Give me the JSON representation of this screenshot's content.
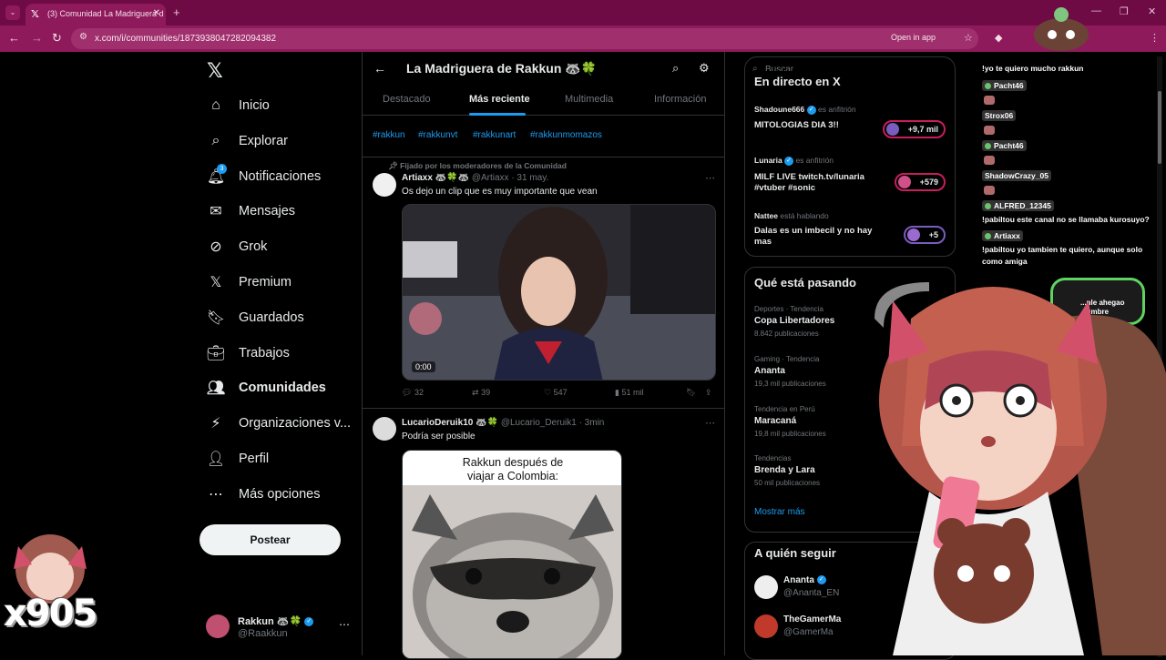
{
  "browser": {
    "tab_title": "(3) Comunidad La Madriguera d",
    "url": "x.com/i/communities/1873938047282094382",
    "open_in_app": "Open in app"
  },
  "nav": {
    "items": [
      {
        "label": "Inicio",
        "icon": "home-icon"
      },
      {
        "label": "Explorar",
        "icon": "search-icon"
      },
      {
        "label": "Notificaciones",
        "icon": "bell-icon",
        "badge": "3"
      },
      {
        "label": "Mensajes",
        "icon": "mail-icon"
      },
      {
        "label": "Grok",
        "icon": "grok-icon"
      },
      {
        "label": "Premium",
        "icon": "x-icon"
      },
      {
        "label": "Guardados",
        "icon": "bookmark-icon"
      },
      {
        "label": "Trabajos",
        "icon": "briefcase-icon"
      },
      {
        "label": "Comunidades",
        "icon": "people-icon"
      },
      {
        "label": "Organizaciones v...",
        "icon": "lightning-icon"
      },
      {
        "label": "Perfil",
        "icon": "person-icon"
      },
      {
        "label": "Más opciones",
        "icon": "more-icon"
      }
    ],
    "post_button": "Postear",
    "profile": {
      "name": "Rakkun 🦝🍀",
      "handle": "@Raakkun"
    }
  },
  "community": {
    "title": "La Madriguera de Rakkun 🦝🍀",
    "tabs": [
      "Destacado",
      "Más reciente",
      "Multimedia",
      "Información"
    ],
    "active_tab": "Más reciente",
    "hashtags": [
      "#rakkun",
      "#rakkunvt",
      "#rakkunart",
      "#rakkunmomazos"
    ]
  },
  "posts": [
    {
      "pinned": "Fijado por los moderadores de la Comunidad",
      "author": "Artiaxx 🦝🍀🦝",
      "handle": "@Artiaxx · 31 may.",
      "text": "Os dejo un clip que es muy importante que vean",
      "video_time": "0:00",
      "replies": "32",
      "reposts": "39",
      "likes": "547",
      "views": "51 mil"
    },
    {
      "author": "LucarioDeruik10 🦝🍀",
      "handle": "@Lucario_Deruik1 · 3min",
      "text": "Podría ser posible",
      "meme_caption": "Rakkun después de viajar a Colombia:"
    }
  ],
  "right": {
    "search_placeholder": "Buscar",
    "live_title": "En directo en X",
    "spaces": [
      {
        "host": "Shadoune666",
        "role": "es anfitrión",
        "title": "MITOLOGIAS DIA 3!!",
        "count": "+9,7 mil"
      },
      {
        "host": "Lunaria",
        "role": "es anfitrión",
        "title": "MILF LIVE twitch.tv/lunaria #vtuber #sonic",
        "count": "+579"
      },
      {
        "host": "Nattee",
        "role": "está hablando",
        "title": "Dalas es un imbecil y no hay mas",
        "count": "+5"
      }
    ],
    "trends_title": "Qué está pasando",
    "trends": [
      {
        "category": "Deportes · Tendencia",
        "name": "Copa Libertadores",
        "posts": "8.842 publicaciones"
      },
      {
        "category": "Gaming · Tendencia",
        "name": "Ananta",
        "posts": "19,3 mil publicaciones"
      },
      {
        "category": "Tendencia en Perú",
        "name": "Maracaná",
        "posts": "19,8 mil publicaciones"
      },
      {
        "category": "Tendencias",
        "name": "Brenda y Lara",
        "posts": "50 mil publicaciones"
      }
    ],
    "show_more": "Mostrar más",
    "follow_title": "A quién seguir",
    "follow": [
      {
        "name": "Ananta",
        "handle": "@Ananta_EN"
      },
      {
        "name": "TheGamerMa",
        "handle": "@GamerMa"
      }
    ]
  },
  "stream_chat": {
    "lines": [
      {
        "type": "text",
        "text": "!yo te quiero mucho rakkun"
      },
      {
        "type": "user",
        "text": "Pacht46"
      },
      {
        "type": "user",
        "text": "Strox06"
      },
      {
        "type": "user",
        "text": "Pacht46"
      },
      {
        "type": "user",
        "text": "ShadowCrazy_05"
      },
      {
        "type": "user",
        "text": "ALFRED_12345"
      },
      {
        "type": "text",
        "text": "!pabiltou este canal no se llamaba kurosuyo?"
      },
      {
        "type": "user",
        "text": "Artiaxx"
      },
      {
        "type": "text",
        "text": "!pabiltou yo tambien te quiero, aunque solo"
      },
      {
        "type": "text",
        "text": "como amiga"
      }
    ],
    "bubble": "...nle ahegao ...umbre"
  },
  "overlay": {
    "multiplier": "x905"
  }
}
